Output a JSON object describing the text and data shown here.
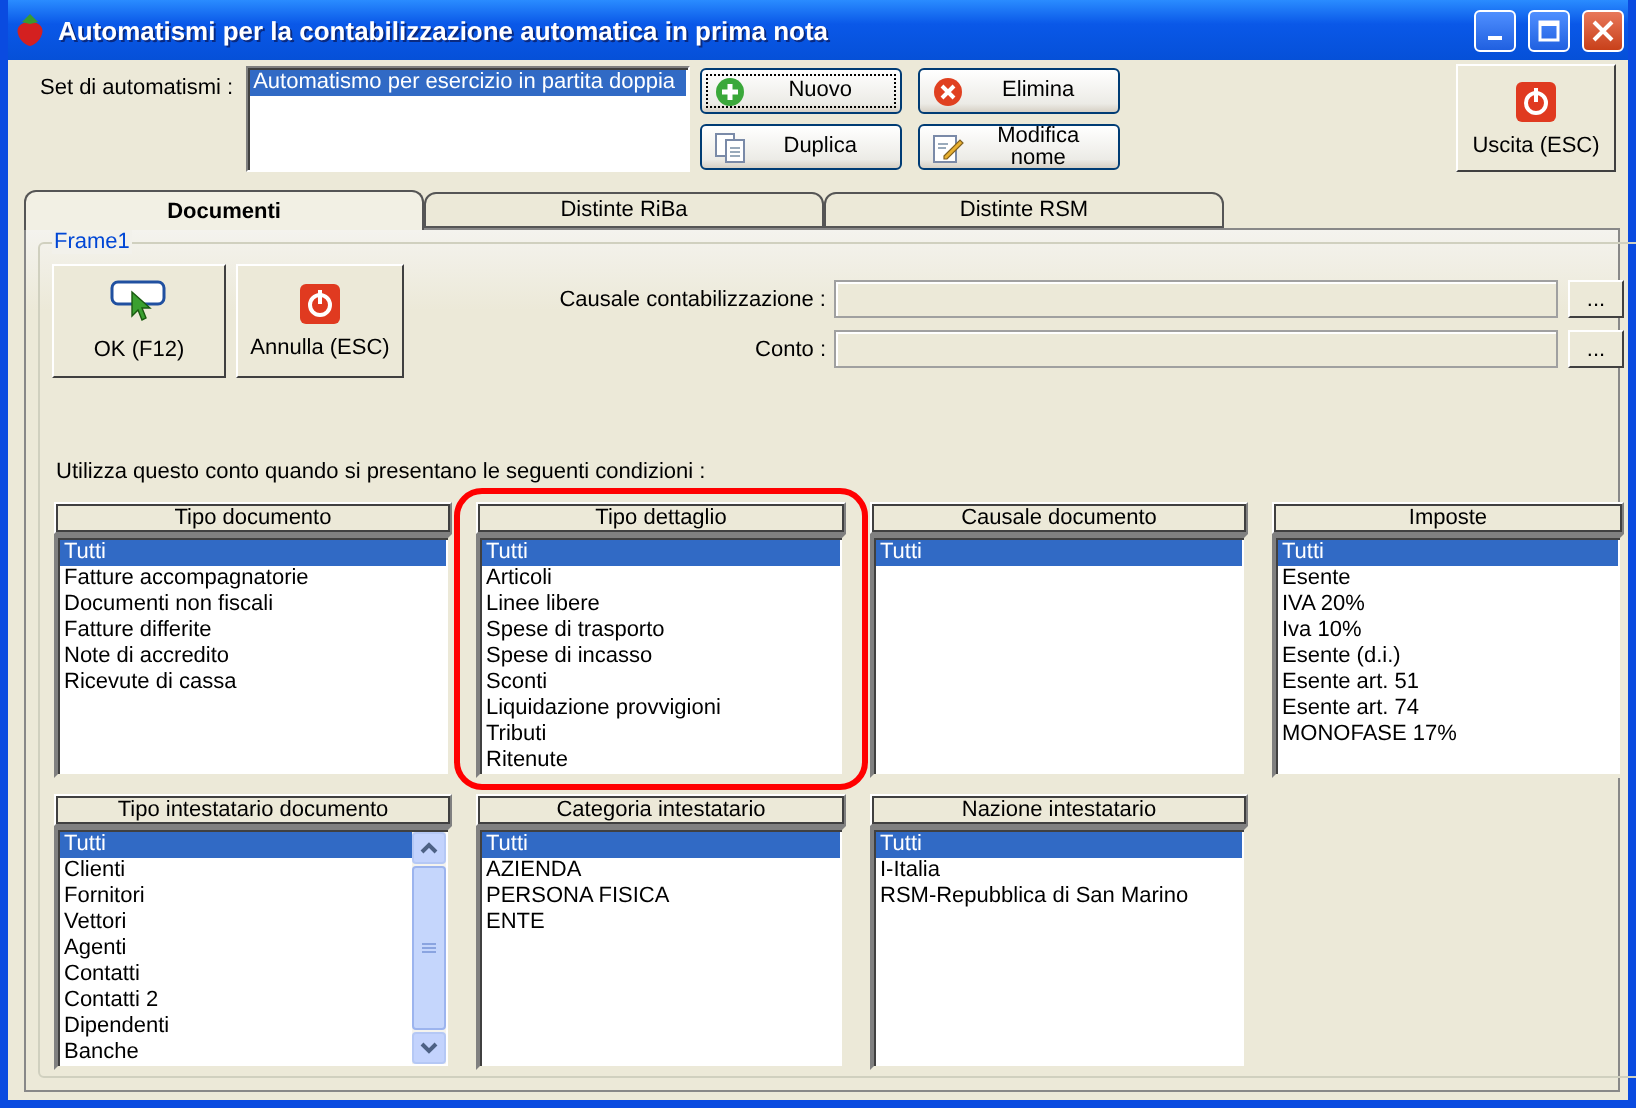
{
  "window": {
    "title": "Automatismi per la contabilizzazione automatica in prima nota"
  },
  "set": {
    "label": "Set di automatismi :",
    "items": [
      {
        "label": "Automatismo per esercizio in partita doppia",
        "selected": true
      }
    ]
  },
  "buttons": [
    {
      "label": "Nuovo",
      "kind": "add",
      "focused": true
    },
    {
      "label": "Elimina",
      "kind": "delete",
      "focused": false
    },
    {
      "label": "Duplica",
      "kind": "copy",
      "focused": false
    },
    {
      "label": "Modifica nome",
      "kind": "rename",
      "focused": false
    }
  ],
  "exit_button": {
    "label": "Uscita (ESC)"
  },
  "tabs": [
    {
      "label": "Documenti",
      "selected": true
    },
    {
      "label": "Distinte RiBa",
      "selected": false
    },
    {
      "label": "Distinte RSM",
      "selected": false
    }
  ],
  "frame": {
    "title": "Frame1",
    "ok_button": {
      "label": "OK (F12)"
    },
    "cancel_button": {
      "label": "Annulla (ESC)"
    },
    "fields": [
      {
        "label": "Causale contabilizzazione :",
        "button": "..."
      },
      {
        "label": "Conto :",
        "button": "..."
      }
    ]
  },
  "conditions": {
    "caption": "Utilizza questo conto quando si presentano le seguenti condizioni :",
    "lists": [
      {
        "title": "Tipo documento",
        "kind": "plain",
        "highlighted": false,
        "items": [
          {
            "label": "Tutti",
            "selected": true
          },
          {
            "label": "Fatture accompagnatorie",
            "selected": false
          },
          {
            "label": "Documenti non fiscali",
            "selected": false
          },
          {
            "label": "Fatture differite",
            "selected": false
          },
          {
            "label": "Note di accredito",
            "selected": false
          },
          {
            "label": "Ricevute di cassa",
            "selected": false
          }
        ]
      },
      {
        "title": "Tipo dettaglio",
        "kind": "plain",
        "highlighted": true,
        "items": [
          {
            "label": "Tutti",
            "selected": true
          },
          {
            "label": "Articoli",
            "selected": false
          },
          {
            "label": "Linee libere",
            "selected": false
          },
          {
            "label": "Spese di trasporto",
            "selected": false
          },
          {
            "label": "Spese di incasso",
            "selected": false
          },
          {
            "label": "Sconti",
            "selected": false
          },
          {
            "label": "Liquidazione provvigioni",
            "selected": false
          },
          {
            "label": "Tributi",
            "selected": false
          },
          {
            "label": "Ritenute",
            "selected": false
          }
        ]
      },
      {
        "title": "Causale documento",
        "kind": "plain",
        "highlighted": false,
        "items": [
          {
            "label": "Tutti",
            "selected": true
          }
        ]
      },
      {
        "title": "Imposte",
        "kind": "plain",
        "highlighted": false,
        "items": [
          {
            "label": "Tutti",
            "selected": true
          },
          {
            "label": "Esente",
            "selected": false
          },
          {
            "label": "IVA 20%",
            "selected": false
          },
          {
            "label": "Iva 10%",
            "selected": false
          },
          {
            "label": "Esente (d.i.)",
            "selected": false
          },
          {
            "label": "Esente art. 51",
            "selected": false
          },
          {
            "label": "Esente art. 74",
            "selected": false
          },
          {
            "label": "MONOFASE 17%",
            "selected": false
          }
        ]
      },
      {
        "title": "Tipo intestatario documento",
        "kind": "scrolling",
        "highlighted": false,
        "items": [
          {
            "label": "Tutti",
            "selected": true
          },
          {
            "label": "Clienti",
            "selected": false
          },
          {
            "label": "Fornitori",
            "selected": false
          },
          {
            "label": "Vettori",
            "selected": false
          },
          {
            "label": "Agenti",
            "selected": false
          },
          {
            "label": "Contatti",
            "selected": false
          },
          {
            "label": "Contatti 2",
            "selected": false
          },
          {
            "label": "Dipendenti",
            "selected": false
          },
          {
            "label": "Banche",
            "selected": false
          }
        ]
      },
      {
        "title": "Categoria intestatario",
        "kind": "plain",
        "highlighted": false,
        "items": [
          {
            "label": "Tutti",
            "selected": true
          },
          {
            "label": "AZIENDA",
            "selected": false
          },
          {
            "label": "PERSONA FISICA",
            "selected": false
          },
          {
            "label": "ENTE",
            "selected": false
          }
        ]
      },
      {
        "title": "Nazione intestatario",
        "kind": "plain",
        "highlighted": false,
        "items": [
          {
            "label": "Tutti",
            "selected": true
          },
          {
            "label": "I-Italia",
            "selected": false
          },
          {
            "label": "RSM-Repubblica di San Marino",
            "selected": false
          }
        ]
      }
    ]
  }
}
